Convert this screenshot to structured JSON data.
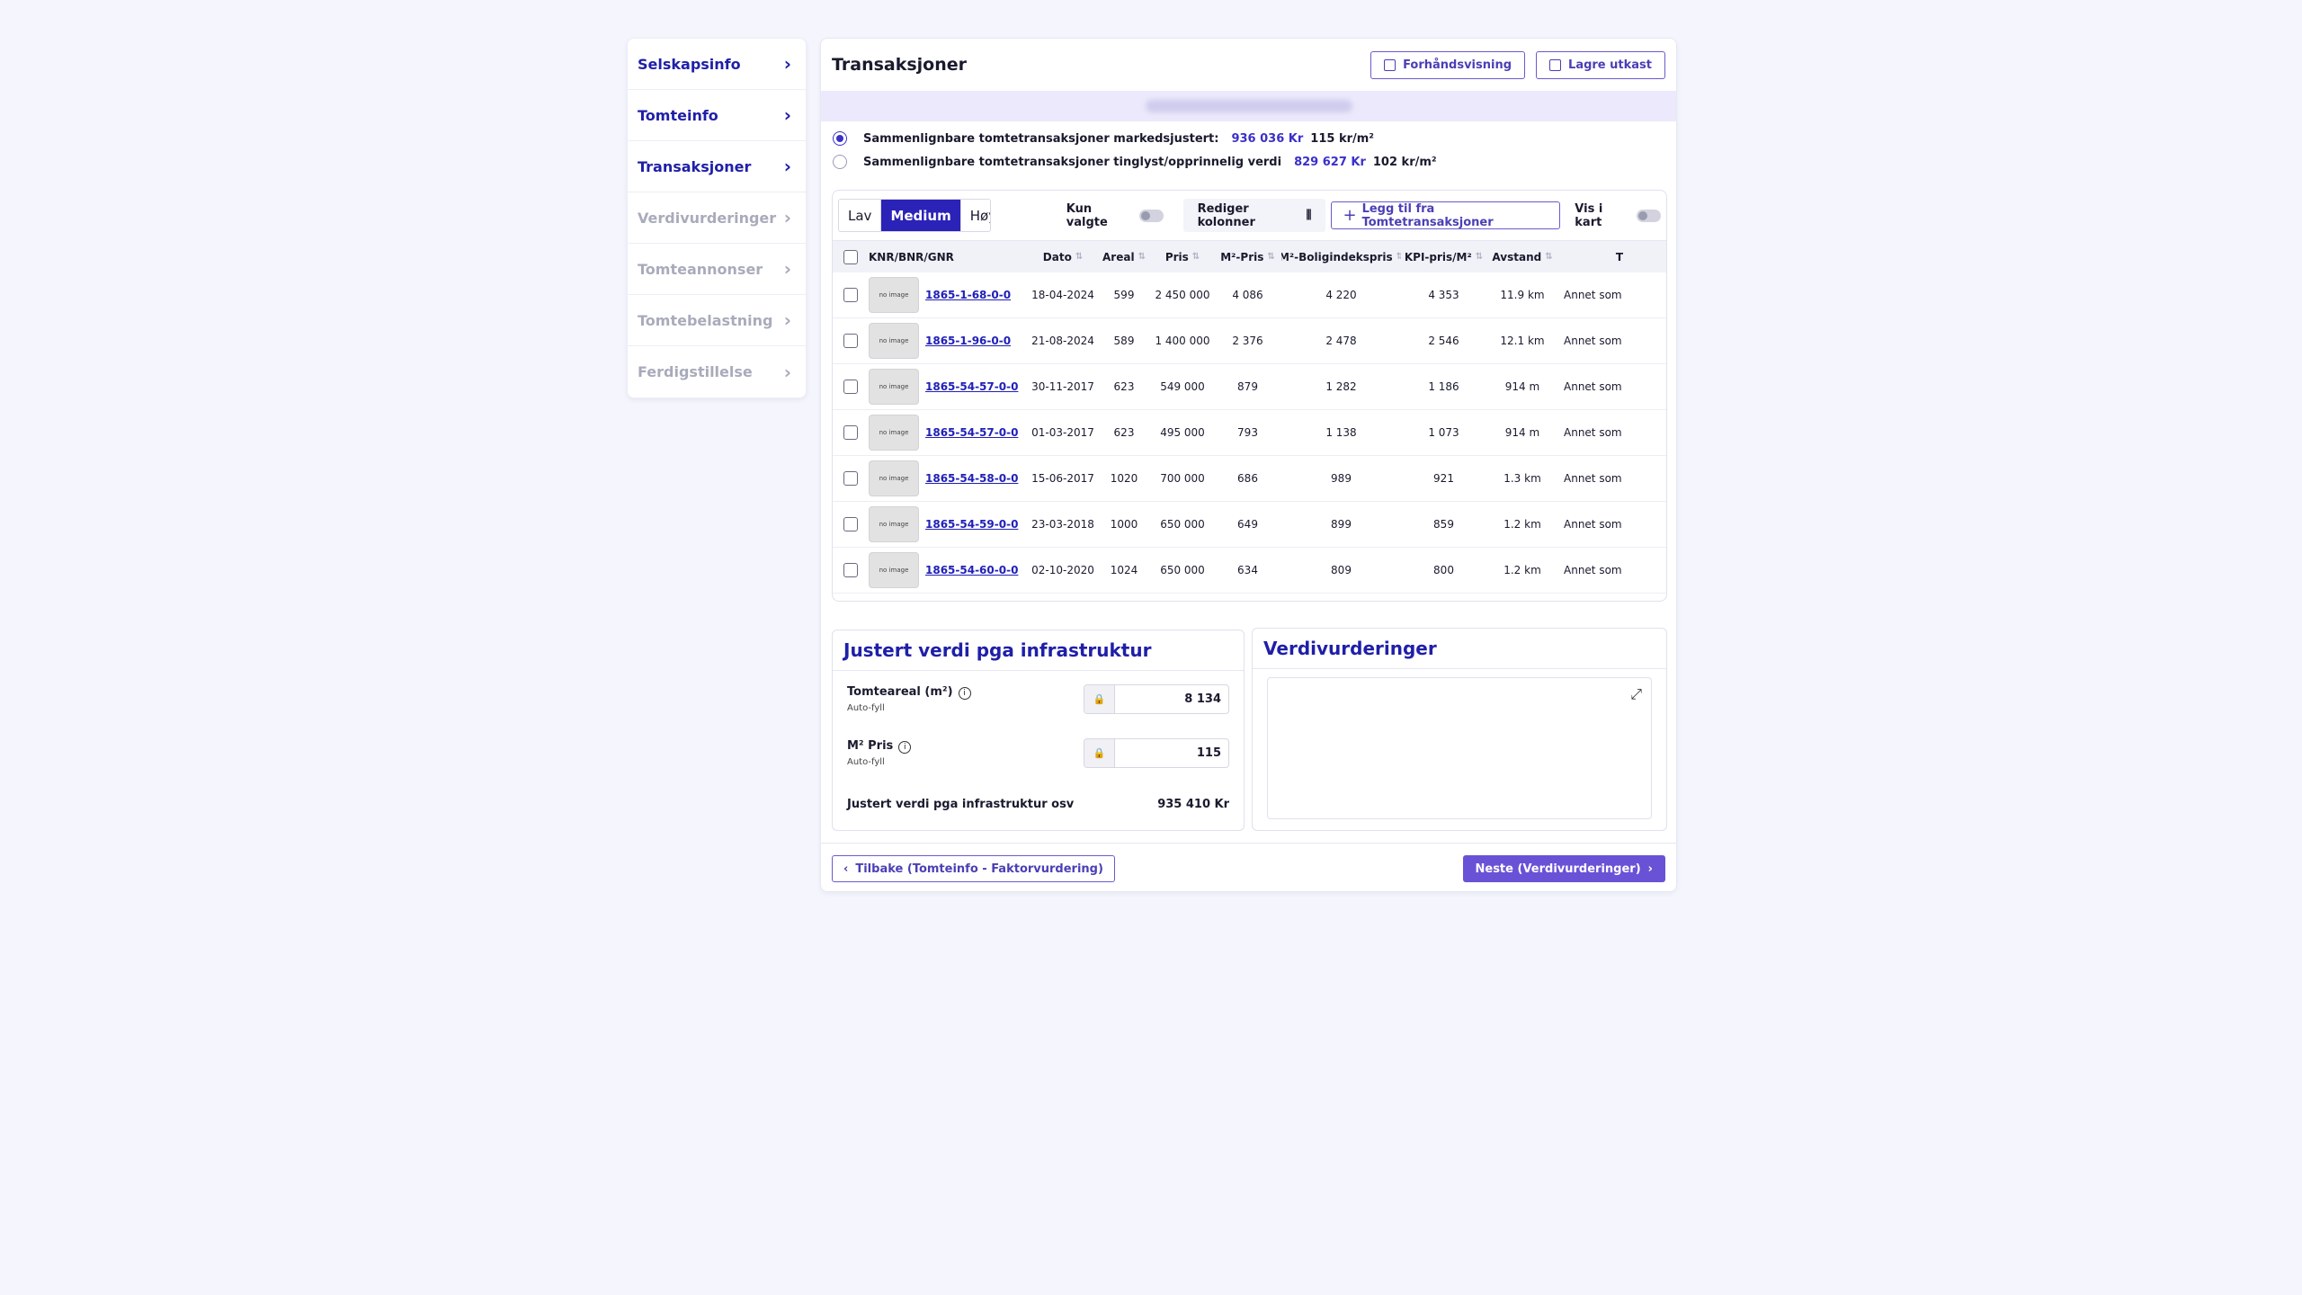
{
  "sidebar": {
    "items": [
      {
        "label": "Selskapsinfo"
      },
      {
        "label": "Tomteinfo"
      },
      {
        "label": "Transaksjoner"
      },
      {
        "label": "Verdivurderinger"
      },
      {
        "label": "Tomteannonser"
      },
      {
        "label": "Tomtebelastning"
      },
      {
        "label": "Ferdigstillelse"
      }
    ]
  },
  "header": {
    "title": "Transaksjoner",
    "preview_label": "Forhåndsvisning",
    "save_label": "Lagre utkast"
  },
  "options": [
    {
      "label": "Sammenlignbare tomtetransaksjoner markedsjustert:",
      "value": "936 036 Kr",
      "per_m2": "115 kr/m²",
      "selected": true
    },
    {
      "label": "Sammenlignbare tomtetransaksjoner tinglyst/opprinnelig verdi",
      "value": "829 627 Kr",
      "per_m2": "102 kr/m²",
      "selected": false
    }
  ],
  "toolbar": {
    "levels": [
      "Lav",
      "Medium",
      "Høy"
    ],
    "selected_level": "Medium",
    "only_selected_label": "Kun valgte",
    "edit_columns_label": "Rediger kolonner",
    "add_label": "Legg til fra Tomtetransaksjoner",
    "show_map_label": "Vis i kart"
  },
  "table": {
    "columns": [
      "KNR/BNR/GNR",
      "Dato",
      "Areal",
      "Pris",
      "M²-Pris",
      "M²-Boligindekspris",
      "KPI-pris/M²",
      "Avstand",
      "T"
    ],
    "thumb_text": "no image",
    "rows": [
      {
        "id": "1865-1-68-0-0",
        "dato": "18-04-2024",
        "areal": "599",
        "pris": "2 450 000",
        "m2": "4 086",
        "bol": "4 220",
        "kpi": "4 353",
        "avstand": "11.9 km",
        "type": "Annet som"
      },
      {
        "id": "1865-1-96-0-0",
        "dato": "21-08-2024",
        "areal": "589",
        "pris": "1 400 000",
        "m2": "2 376",
        "bol": "2 478",
        "kpi": "2 546",
        "avstand": "12.1 km",
        "type": "Annet som"
      },
      {
        "id": "1865-54-57-0-0",
        "dato": "30-11-2017",
        "areal": "623",
        "pris": "549 000",
        "m2": "879",
        "bol": "1 282",
        "kpi": "1 186",
        "avstand": "914 m",
        "type": "Annet som"
      },
      {
        "id": "1865-54-57-0-0",
        "dato": "01-03-2017",
        "areal": "623",
        "pris": "495 000",
        "m2": "793",
        "bol": "1 138",
        "kpi": "1 073",
        "avstand": "914 m",
        "type": "Annet som"
      },
      {
        "id": "1865-54-58-0-0",
        "dato": "15-06-2017",
        "areal": "1020",
        "pris": "700 000",
        "m2": "686",
        "bol": "989",
        "kpi": "921",
        "avstand": "1.3 km",
        "type": "Annet som"
      },
      {
        "id": "1865-54-59-0-0",
        "dato": "23-03-2018",
        "areal": "1000",
        "pris": "650 000",
        "m2": "649",
        "bol": "899",
        "kpi": "859",
        "avstand": "1.2 km",
        "type": "Annet som"
      },
      {
        "id": "1865-54-60-0-0",
        "dato": "02-10-2020",
        "areal": "1024",
        "pris": "650 000",
        "m2": "634",
        "bol": "809",
        "kpi": "800",
        "avstand": "1.2 km",
        "type": "Annet som"
      }
    ]
  },
  "adjusted": {
    "title": "Justert verdi pga infrastruktur",
    "area_label": "Tomteareal (m²)",
    "area_sub": "Auto-fyll",
    "area_value": "8 134",
    "price_label": "M² Pris",
    "price_sub": "Auto-fyll",
    "price_value": "115",
    "total_label": "Justert verdi pga infrastruktur osv",
    "total_value": "935 410 Kr"
  },
  "valuations": {
    "title": "Verdivurderinger"
  },
  "footer": {
    "back_label": "Tilbake (Tomteinfo - Faktorvurdering)",
    "next_label": "Neste (Verdivurderinger)"
  }
}
